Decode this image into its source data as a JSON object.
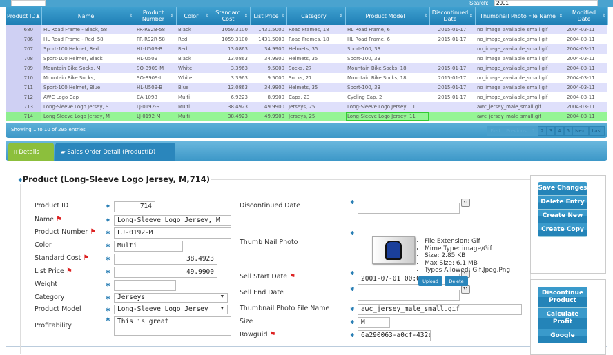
{
  "search": {
    "label": "Search:",
    "value": "2001"
  },
  "grid": {
    "columns": [
      "Product ID",
      "Name",
      "Product Number",
      "Color",
      "Standard Cost",
      "List Price",
      "Category",
      "Product Model",
      "Discontinued Date",
      "Thumbnail Photo File Name",
      "Modified Date"
    ],
    "rows": [
      [
        "680",
        "HL Road Frame - Black, 58",
        "FR-R92B-58",
        "Black",
        "1059.3100",
        "1431.5000",
        "Road Frames, 18",
        "HL Road Frame, 6",
        "2015-01-17",
        "no_image_available_small.gif",
        "2004-03-11"
      ],
      [
        "706",
        "HL Road Frame - Red, 58",
        "FR-R92R-58",
        "Red",
        "1059.3100",
        "1431.5000",
        "Road Frames, 18",
        "HL Road Frame, 6",
        "2015-01-17",
        "no_image_available_small.gif",
        "2004-03-11"
      ],
      [
        "707",
        "Sport-100 Helmet, Red",
        "HL-U509-R",
        "Red",
        "13.0863",
        "34.9900",
        "Helmets, 35",
        "Sport-100, 33",
        "",
        "no_image_available_small.gif",
        "2004-03-11"
      ],
      [
        "708",
        "Sport-100 Helmet, Black",
        "HL-U509",
        "Black",
        "13.0863",
        "34.9900",
        "Helmets, 35",
        "Sport-100, 33",
        "",
        "no_image_available_small.gif",
        "2004-03-11"
      ],
      [
        "709",
        "Mountain Bike Socks, M",
        "SO-B909-M",
        "White",
        "3.3963",
        "9.5000",
        "Socks, 27",
        "Mountain Bike Socks, 18",
        "2015-01-17",
        "no_image_available_small.gif",
        "2004-03-11"
      ],
      [
        "710",
        "Mountain Bike Socks, L",
        "SO-B909-L",
        "White",
        "3.3963",
        "9.5000",
        "Socks, 27",
        "Mountain Bike Socks, 18",
        "2015-01-17",
        "no_image_available_small.gif",
        "2004-03-11"
      ],
      [
        "711",
        "Sport-100 Helmet, Blue",
        "HL-U509-B",
        "Blue",
        "13.0863",
        "34.9900",
        "Helmets, 35",
        "Sport-100, 33",
        "2015-01-17",
        "no_image_available_small.gif",
        "2004-03-11"
      ],
      [
        "712",
        "AWC Logo Cap",
        "CA-1098",
        "Multi",
        "6.9223",
        "8.9900",
        "Caps, 23",
        "Cycling Cap, 2",
        "2015-01-17",
        "no_image_available_small.gif",
        "2004-03-11"
      ],
      [
        "713",
        "Long-Sleeve Logo Jersey, S",
        "LJ-0192-S",
        "Multi",
        "38.4923",
        "49.9900",
        "Jerseys, 25",
        "Long-Sleeve Logo Jersey, 11",
        "",
        "awc_jersey_male_small.gif",
        "2004-03-11"
      ],
      [
        "714",
        "Long-Sleeve Logo Jersey, M",
        "LJ-0192-M",
        "Multi",
        "38.4923",
        "49.9900",
        "Jerseys, 25",
        "Long-Sleeve Logo Jersey, 11",
        "",
        "awc_jersey_male_small.gif",
        "2004-03-11"
      ]
    ],
    "selected_row": 9,
    "info": "Showing 1 to 10 of 295 entries",
    "pager": [
      "First",
      "Previous",
      "1",
      "2",
      "3",
      "4",
      "5",
      "Next",
      "Last"
    ]
  },
  "tabs": [
    "Details",
    "Sales Order Detail (ProductID)"
  ],
  "form": {
    "title": "Product (Long-Sleeve Logo Jersey, M,714)",
    "product_id": {
      "label": "Product ID",
      "value": "714"
    },
    "name": {
      "label": "Name",
      "value": "Long-Sleeve Logo Jersey, M"
    },
    "product_number": {
      "label": "Product Number",
      "value": "LJ-0192-M"
    },
    "color": {
      "label": "Color",
      "value": "Multi"
    },
    "standard_cost": {
      "label": "Standard Cost",
      "value": "38.4923"
    },
    "list_price": {
      "label": "List Price",
      "value": "49.9900"
    },
    "weight": {
      "label": "Weight",
      "value": ""
    },
    "category": {
      "label": "Category",
      "value": "Jerseys"
    },
    "product_model": {
      "label": "Product Model",
      "value": "Long-Sleeve Logo Jersey"
    },
    "profitability": {
      "label": "Profitability",
      "value": "This is great"
    },
    "discontinued_date": {
      "label": "Discontinued Date",
      "value": ""
    },
    "thumb": {
      "label": "Thumb Nail Photo",
      "info": [
        "File Extension: Gif",
        "Mime Type: image/Gif",
        "Size: 2.85 KB",
        "Max Size: 6.1 MB",
        "Types Allowed: Gif,Jpeg,Png"
      ],
      "upload": "Upload",
      "delete": "Delete"
    },
    "sell_start": {
      "label": "Sell Start Date",
      "value": "2001-07-01 00:00:00"
    },
    "sell_end": {
      "label": "Sell End Date",
      "value": ""
    },
    "thumb_file": {
      "label": "Thumbnail Photo File Name",
      "value": "awc_jersey_male_small.gif"
    },
    "size": {
      "label": "Size",
      "value": "M"
    },
    "rowguid": {
      "label": "Rowguid",
      "value": "6a290063-a0cf-432a"
    },
    "cal": "31"
  },
  "actions": [
    "Save Changes",
    "Delete Entry",
    "Create New",
    "Create Copy"
  ],
  "actions2": [
    "Discontinue Product",
    "Calculate Profit",
    "Google"
  ]
}
